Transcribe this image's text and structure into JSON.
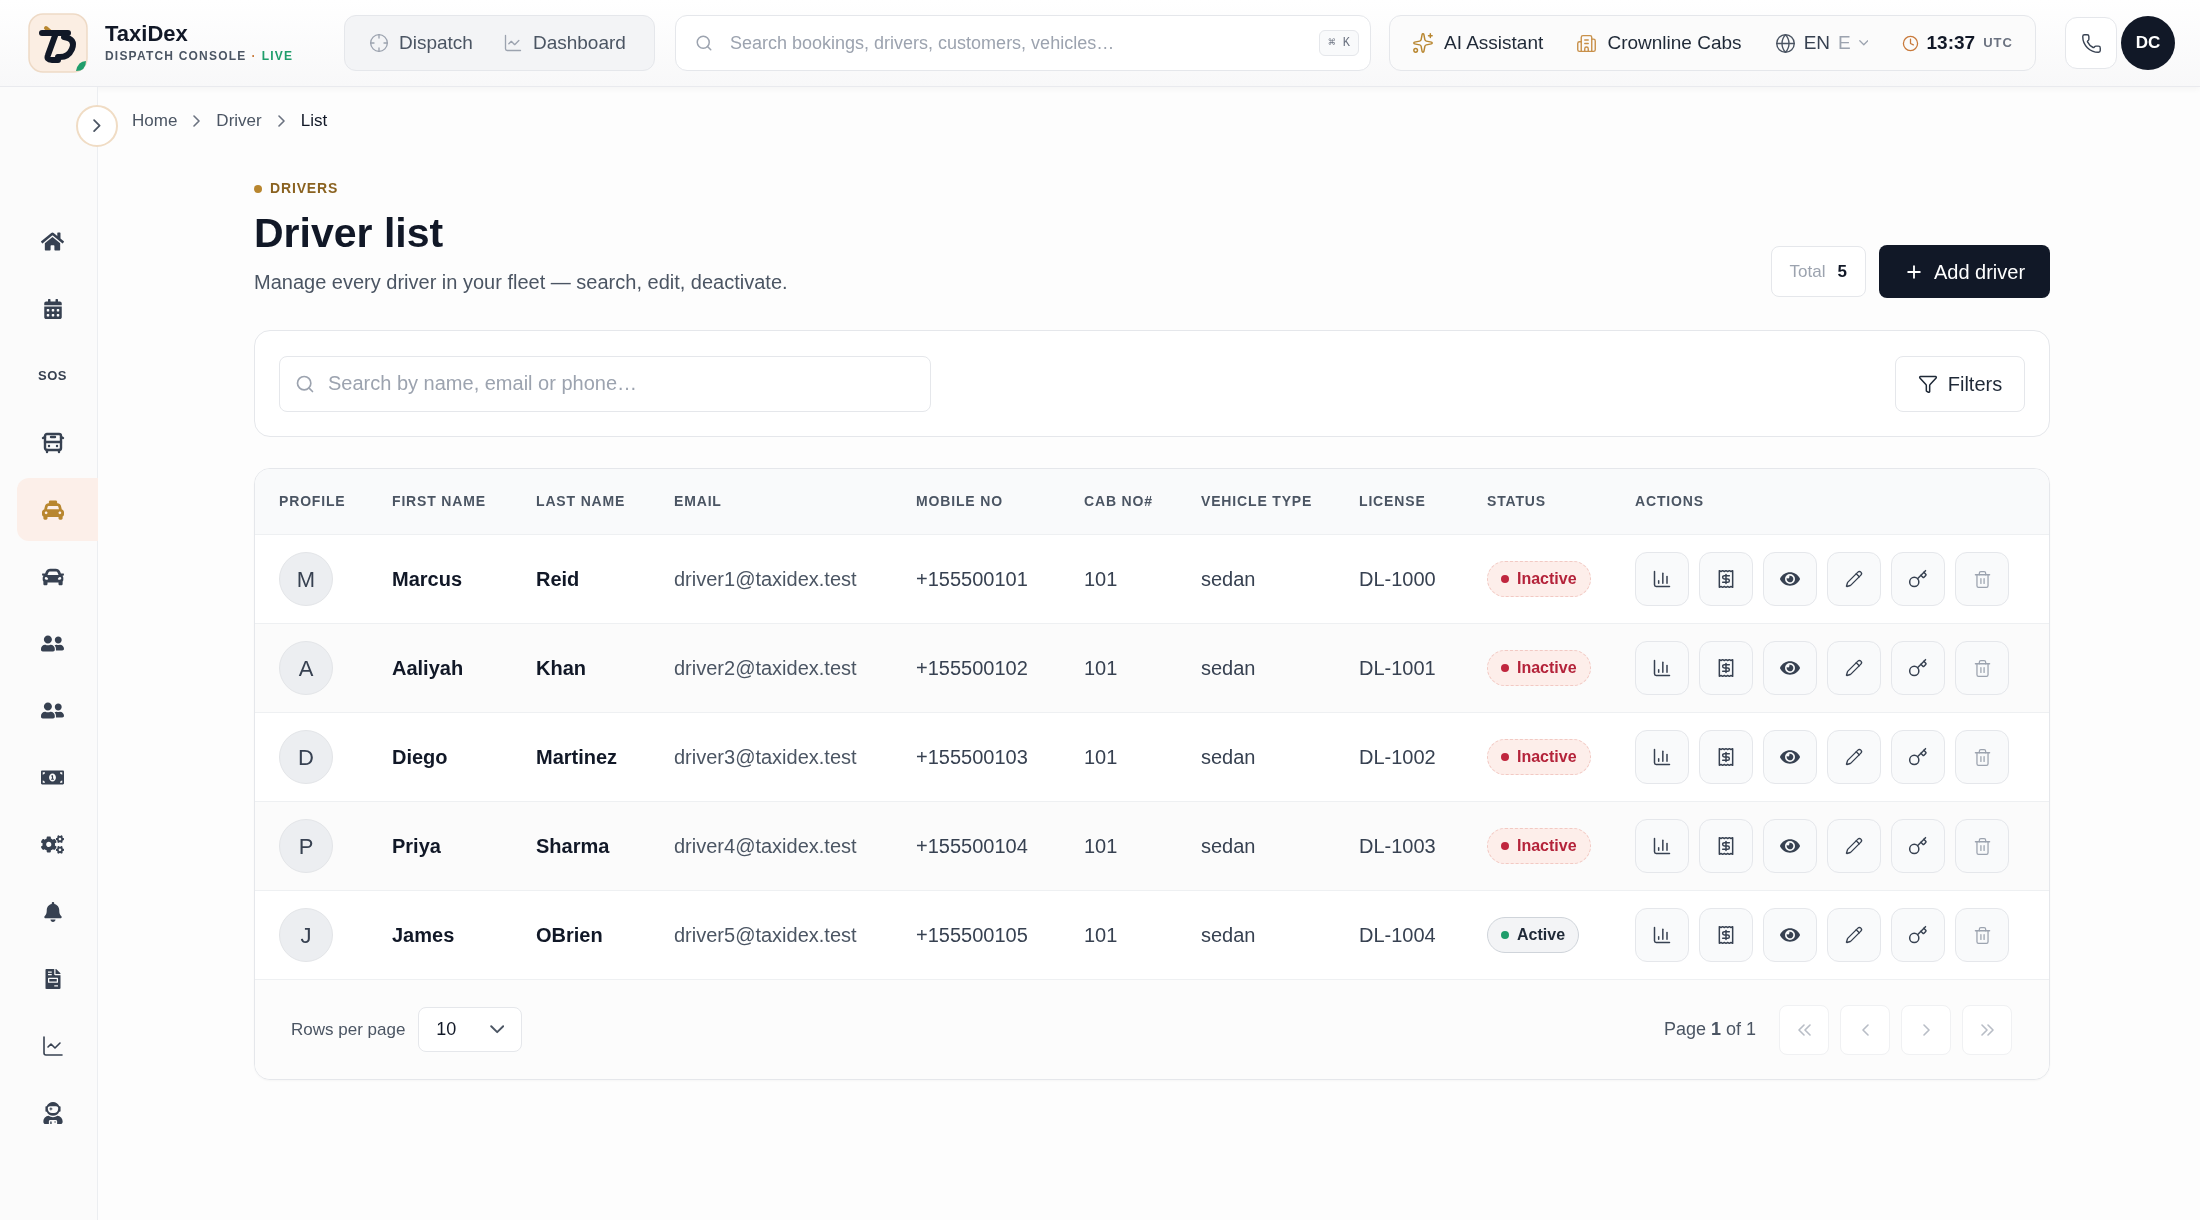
{
  "topbar": {
    "brand": {
      "name": "TaxiDex",
      "subtitle": "DISPATCH CONSOLE",
      "separator": "·",
      "status": "LIVE"
    },
    "nav": [
      {
        "kind": "dispatch",
        "label": "Dispatch"
      },
      {
        "kind": "dashboard",
        "label": "Dashboard"
      }
    ],
    "search": {
      "placeholder": "Search bookings, drivers, customers, vehicles…",
      "shortcut": "⌘ K"
    },
    "tools": [
      {
        "kind": "assistant",
        "label": "AI Assistant"
      },
      {
        "kind": "company",
        "label": "Crownline Cabs"
      },
      {
        "kind": "language",
        "label": "EN",
        "sublabel": "E"
      },
      {
        "kind": "clock",
        "label": "13:37",
        "sublabel": "UTC"
      }
    ],
    "avatar": "DC"
  },
  "sidebar": {
    "items": [
      {
        "kind": "home",
        "selected": false
      },
      {
        "kind": "calendar",
        "selected": false
      },
      {
        "kind": "sos",
        "label": "SOS",
        "selected": false
      },
      {
        "kind": "bus",
        "selected": false
      },
      {
        "kind": "taxi",
        "selected": true
      },
      {
        "kind": "car",
        "selected": false
      },
      {
        "kind": "users",
        "selected": false
      },
      {
        "kind": "users",
        "selected": false
      },
      {
        "kind": "money",
        "selected": false
      },
      {
        "kind": "settings",
        "selected": false
      },
      {
        "kind": "alert",
        "selected": false
      },
      {
        "kind": "report",
        "selected": false
      },
      {
        "kind": "analytics",
        "selected": false
      },
      {
        "kind": "agent",
        "selected": false
      }
    ]
  },
  "breadcrumb": [
    "Home",
    "Driver",
    "List"
  ],
  "page_header": {
    "eyebrow": "DRIVERS",
    "title": "Driver list",
    "description": "Manage every driver in your fleet — search, edit, deactivate.",
    "total": {
      "label": "Total",
      "value": "5"
    },
    "add_button": "Add driver"
  },
  "filters": {
    "search": {
      "placeholder": "Search by name, email or phone…"
    },
    "button": "Filters"
  },
  "table": {
    "columns": [
      "PROFILE",
      "FIRST NAME",
      "LAST NAME",
      "EMAIL",
      "MOBILE NO",
      "CAB NO#",
      "VEHICLE TYPE",
      "LICENSE",
      "STATUS",
      "ACTIONS"
    ],
    "rows": [
      {
        "initial": "M",
        "first_name": "Marcus",
        "last_name": "Reid",
        "email": "driver1@taxidex.test",
        "mobile": "+155500101",
        "cab_no": "101",
        "vehicle_type": "sedan",
        "license": "DL-1000",
        "status": {
          "label": "Inactive",
          "active": false
        }
      },
      {
        "initial": "A",
        "first_name": "Aaliyah",
        "last_name": "Khan",
        "email": "driver2@taxidex.test",
        "mobile": "+155500102",
        "cab_no": "101",
        "vehicle_type": "sedan",
        "license": "DL-1001",
        "status": {
          "label": "Inactive",
          "active": false
        }
      },
      {
        "initial": "D",
        "first_name": "Diego",
        "last_name": "Martinez",
        "email": "driver3@taxidex.test",
        "mobile": "+155500103",
        "cab_no": "101",
        "vehicle_type": "sedan",
        "license": "DL-1002",
        "status": {
          "label": "Inactive",
          "active": false
        }
      },
      {
        "initial": "P",
        "first_name": "Priya",
        "last_name": "Sharma",
        "email": "driver4@taxidex.test",
        "mobile": "+155500104",
        "cab_no": "101",
        "vehicle_type": "sedan",
        "license": "DL-1003",
        "status": {
          "label": "Inactive",
          "active": false
        }
      },
      {
        "initial": "J",
        "first_name": "James",
        "last_name": "OBrien",
        "email": "driver5@taxidex.test",
        "mobile": "+155500105",
        "cab_no": "101",
        "vehicle_type": "sedan",
        "license": "DL-1004",
        "status": {
          "label": "Active",
          "active": true
        }
      }
    ]
  },
  "pagination": {
    "rows_per_page": {
      "label": "Rows per page",
      "value": "10"
    },
    "page_info": "Page **1** of 1",
    "buttons": [
      {
        "kind": "first",
        "disabled": true
      },
      {
        "kind": "previous",
        "disabled": true
      },
      {
        "kind": "next",
        "disabled": true
      },
      {
        "kind": "last",
        "disabled": true
      }
    ]
  }
}
